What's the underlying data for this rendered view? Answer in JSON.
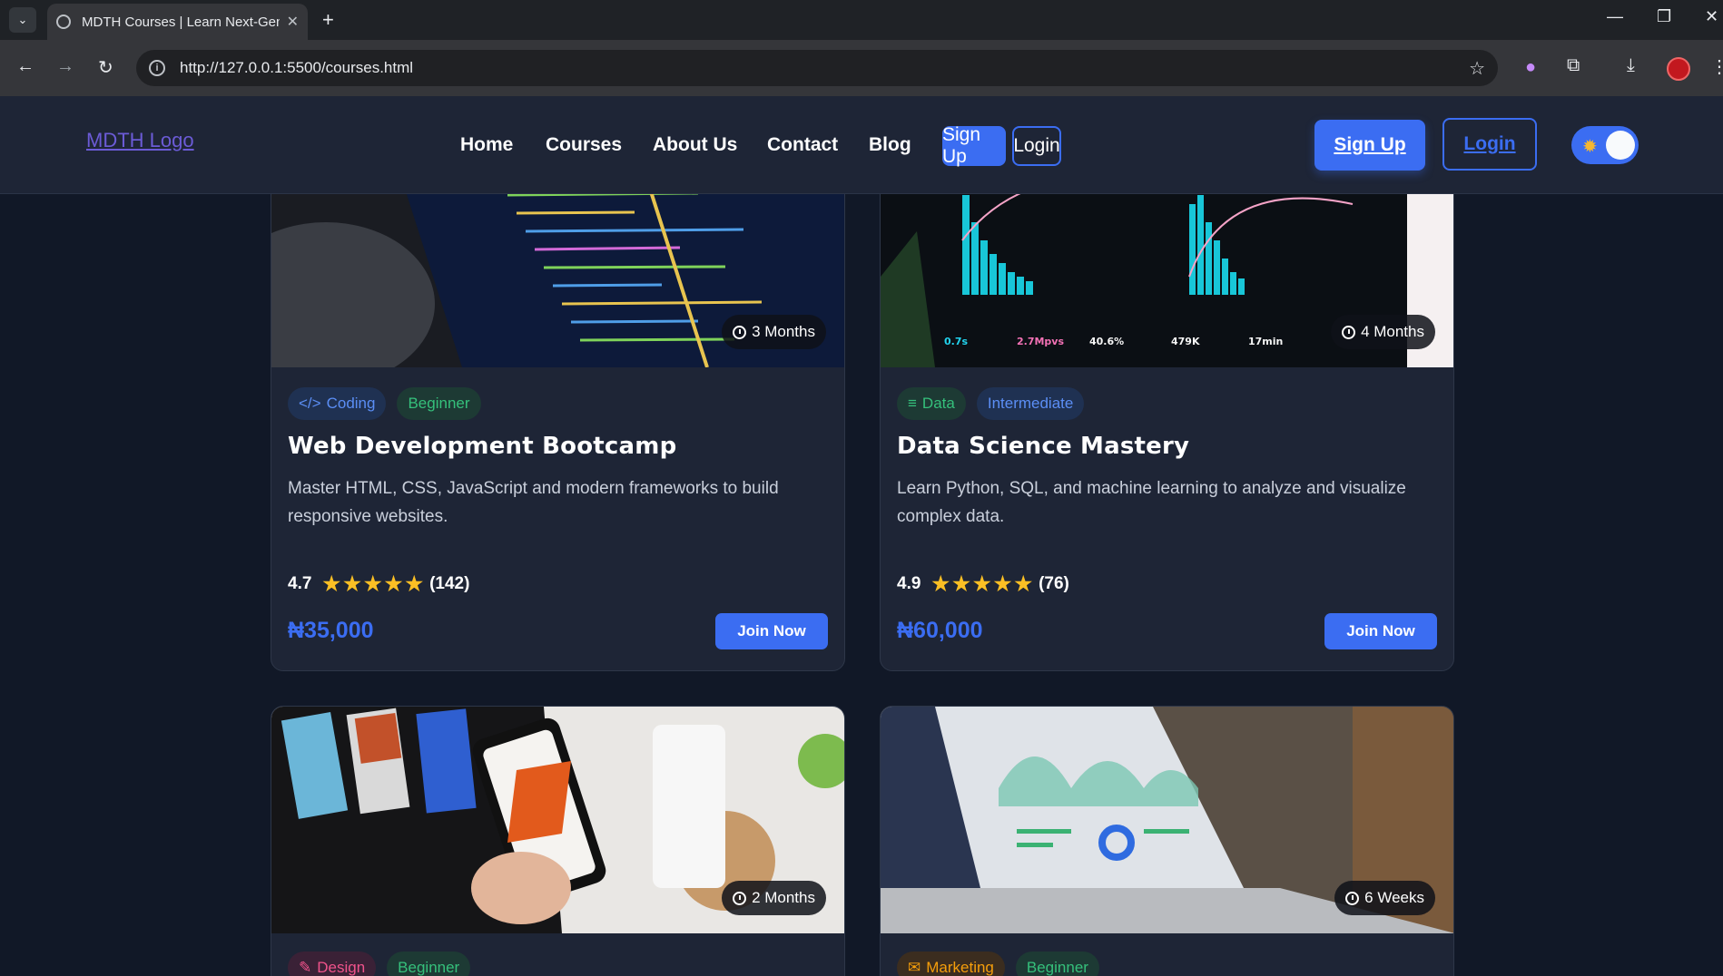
{
  "browser": {
    "tab_title": "MDTH Courses | Learn Next-Gen",
    "url": "http://127.0.0.1:5500/courses.html"
  },
  "site": {
    "logo_alt": "MDTH Logo",
    "nav": [
      "Home",
      "Courses",
      "About Us",
      "Contact",
      "Blog"
    ],
    "nav_signup": "Sign Up",
    "nav_login": "Login",
    "signup": "Sign Up",
    "login": "Login"
  },
  "colors": {
    "accent": "#3b6df2",
    "background": "#111827",
    "card": "#1e2536",
    "star": "#fbbf24"
  },
  "courses": [
    {
      "duration": "3 Months",
      "category": "Coding",
      "category_icon": "code-icon",
      "level": "Beginner",
      "title": "Web Development Bootcamp",
      "description": "Master HTML, CSS, JavaScript and modern frameworks to build responsive websites.",
      "rating": "4.7",
      "stars": 5,
      "reviews": "(142)",
      "price": "₦35,000",
      "cta": "Join Now"
    },
    {
      "duration": "4 Months",
      "category": "Data",
      "category_icon": "database-icon",
      "level": "Intermediate",
      "title": "Data Science Mastery",
      "description": "Learn Python, SQL, and machine learning to analyze and visualize complex data.",
      "rating": "4.9",
      "stars": 5,
      "reviews": "(76)",
      "price": "₦60,000",
      "cta": "Join Now"
    },
    {
      "duration": "2 Months",
      "category": "Design",
      "category_icon": "brush-icon",
      "level": "Beginner"
    },
    {
      "duration": "6 Weeks",
      "category": "Marketing",
      "category_icon": "mail-icon",
      "level": "Beginner"
    }
  ]
}
